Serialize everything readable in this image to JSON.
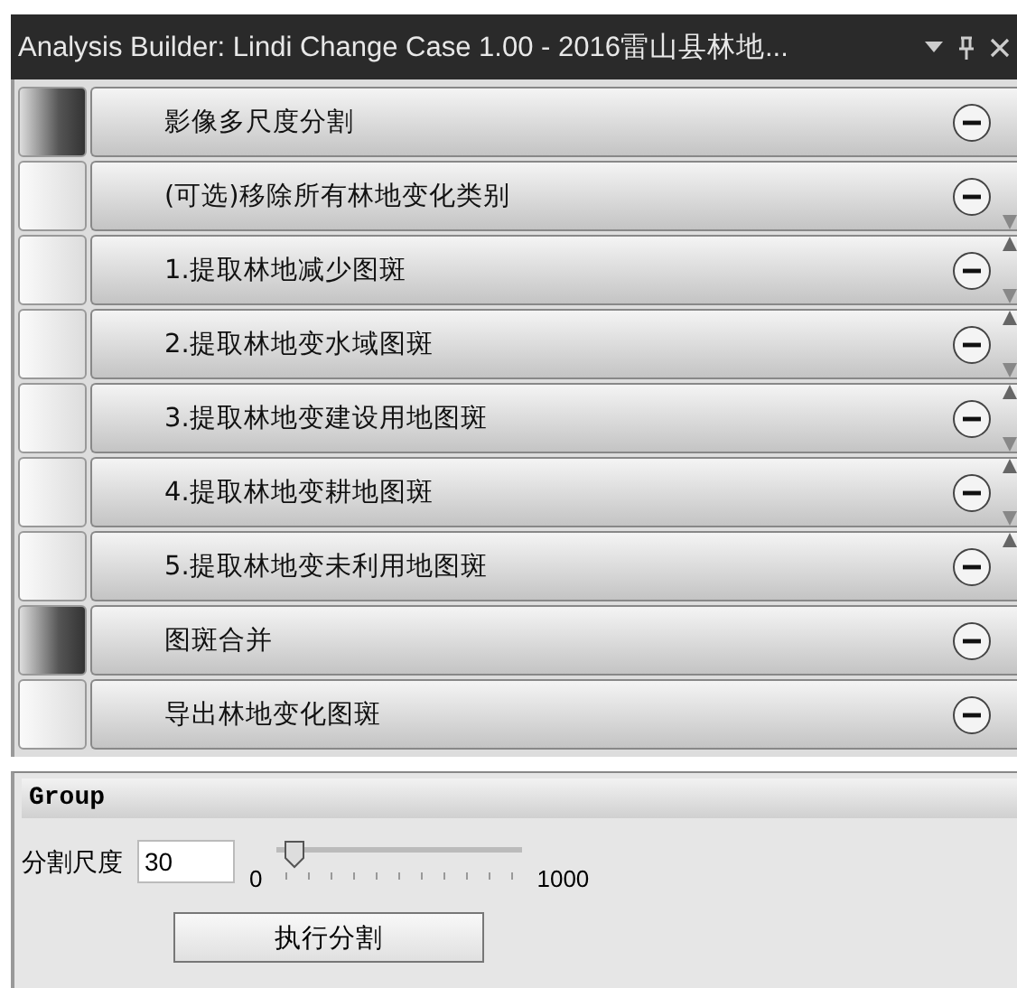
{
  "window": {
    "title": "Analysis Builder: Lindi Change Case 1.00 - 2016雷山县林地..."
  },
  "processes": [
    {
      "label": "影像多尺度分割",
      "highlighted": true,
      "move_up": false,
      "move_down": false
    },
    {
      "label": "(可选)移除所有林地变化类别",
      "highlighted": false,
      "move_up": false,
      "move_down": true
    },
    {
      "label": "1.提取林地减少图斑",
      "highlighted": false,
      "move_up": true,
      "move_down": true
    },
    {
      "label": "2.提取林地变水域图斑",
      "highlighted": false,
      "move_up": true,
      "move_down": true
    },
    {
      "label": "3.提取林地变建设用地图斑",
      "highlighted": false,
      "move_up": true,
      "move_down": true
    },
    {
      "label": "4.提取林地变耕地图斑",
      "highlighted": false,
      "move_up": true,
      "move_down": true
    },
    {
      "label": "5.提取林地变未利用地图斑",
      "highlighted": false,
      "move_up": true,
      "move_down": false
    },
    {
      "label": "图斑合并",
      "highlighted": true,
      "move_up": false,
      "move_down": false
    },
    {
      "label": "导出林地变化图斑",
      "highlighted": false,
      "move_up": false,
      "move_down": false
    }
  ],
  "group": {
    "title": "Group",
    "field_label": "分割尺度",
    "field_value": "30",
    "slider": {
      "min": "0",
      "max": "1000",
      "level": 0.03
    },
    "button": "执行分割"
  }
}
